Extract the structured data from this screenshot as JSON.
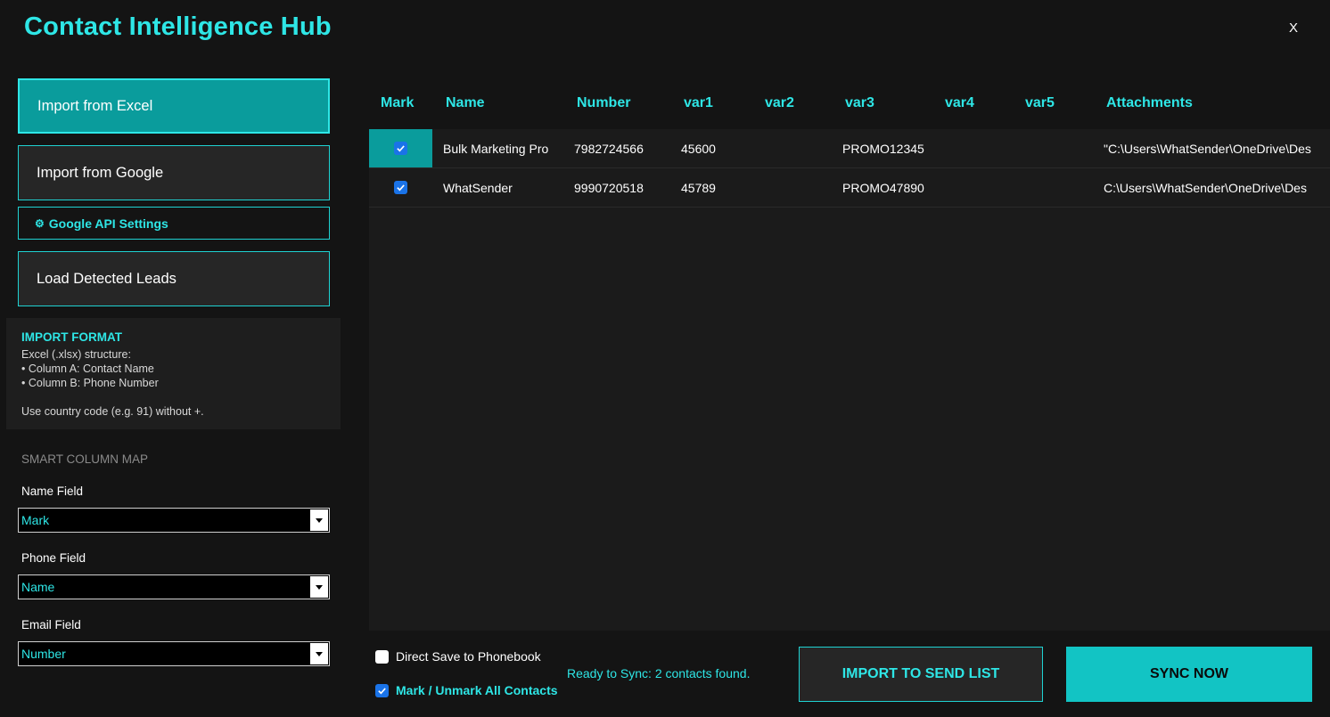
{
  "app": {
    "title": "Contact Intelligence Hub",
    "close_label": "X"
  },
  "sidebar": {
    "import_excel_label": "Import from Excel",
    "import_google_label": "Import from Google",
    "google_api_label": "Google API Settings",
    "load_leads_label": "Load Detected Leads",
    "import_format": {
      "title": "IMPORT FORMAT",
      "lines": [
        "Excel (.xlsx) structure:",
        "• Column A: Contact Name",
        "• Column B: Phone Number"
      ],
      "note": "Use country code (e.g. 91) without +."
    },
    "column_map": {
      "title": "SMART COLUMN MAP",
      "name_label": "Name Field",
      "name_value": "Mark",
      "phone_label": "Phone Field",
      "phone_value": "Name",
      "email_label": "Email Field",
      "email_value": "Number"
    }
  },
  "table": {
    "columns": [
      "Mark",
      "Name",
      "Number",
      "var1",
      "var2",
      "var3",
      "var4",
      "var5",
      "Attachments"
    ],
    "rows": [
      {
        "checked": true,
        "selected": true,
        "cells": [
          "Bulk Marketing Pro",
          "7982724566",
          "45600",
          "",
          "PROMO12345",
          "",
          "",
          "\"C:\\Users\\WhatSender\\OneDrive\\Des"
        ]
      },
      {
        "checked": true,
        "selected": false,
        "cells": [
          "WhatSender",
          "9990720518",
          "45789",
          "",
          "PROMO47890",
          "",
          "",
          "C:\\Users\\WhatSender\\OneDrive\\Des"
        ]
      }
    ]
  },
  "footer": {
    "direct_save_label": "Direct Save to Phonebook",
    "direct_save_checked": false,
    "mark_all_label": "Mark / Unmark All Contacts",
    "mark_all_checked": true,
    "status_text": "Ready to Sync: 2 contacts found.",
    "import_button_label": "IMPORT TO SEND LIST",
    "sync_button_label": "SYNC NOW"
  },
  "colors": {
    "accent": "#2ee6e6",
    "accent_dark": "#0a9c9c",
    "background": "#141414",
    "checkbox": "#1a73e8"
  }
}
